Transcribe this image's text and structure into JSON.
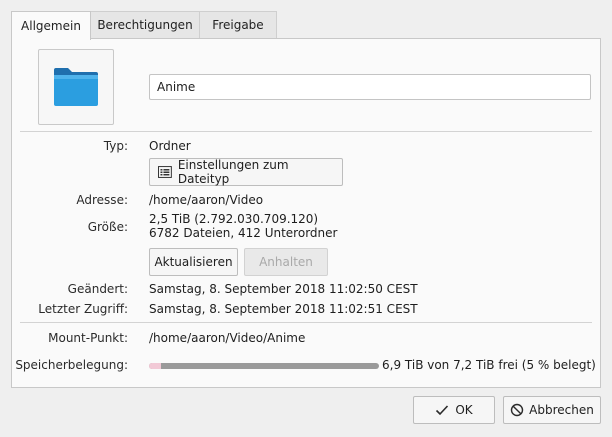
{
  "tabs": [
    {
      "label": "Allgemein",
      "active": true
    },
    {
      "label": "Berechtigungen",
      "active": false
    },
    {
      "label": "Freigabe",
      "active": false
    }
  ],
  "general": {
    "name_value": "Anime",
    "type_label": "Typ:",
    "type_value": "Ordner",
    "filetype_button": "Einstellungen zum Dateityp",
    "address_label": "Adresse:",
    "address_value": "/home/aaron/Video",
    "size_label": "Größe:",
    "size_value_line1": "2,5 TiB (2.792.030.709.120)",
    "size_value_line2": "6782 Dateien, 412 Unterordner",
    "refresh_button": "Aktualisieren",
    "stop_button": "Anhalten",
    "modified_label": "Geändert:",
    "modified_value": "Samstag, 8. September 2018 11:02:50 CEST",
    "accessed_label": "Letzter Zugriff:",
    "accessed_value": "Samstag, 8. September 2018 11:02:51 CEST",
    "mount_label": "Mount-Punkt:",
    "mount_value": "/home/aaron/Video/Anime",
    "usage_label": "Speicherbelegung:",
    "usage_text": "6,9 TiB von 7,2 TiB frei (5 % belegt)",
    "usage_fraction": 0.05
  },
  "footer": {
    "ok_label": "OK",
    "cancel_label": "Abbrechen"
  },
  "icons": {
    "folder": "folder-icon",
    "filetype": "list-settings-icon",
    "ok": "checkmark-icon",
    "cancel": "cancel-icon"
  },
  "colors": {
    "folder_blue": "#2b9ee0",
    "usage_fill": "#f2c9d6",
    "usage_track": "#9a9a9a"
  }
}
